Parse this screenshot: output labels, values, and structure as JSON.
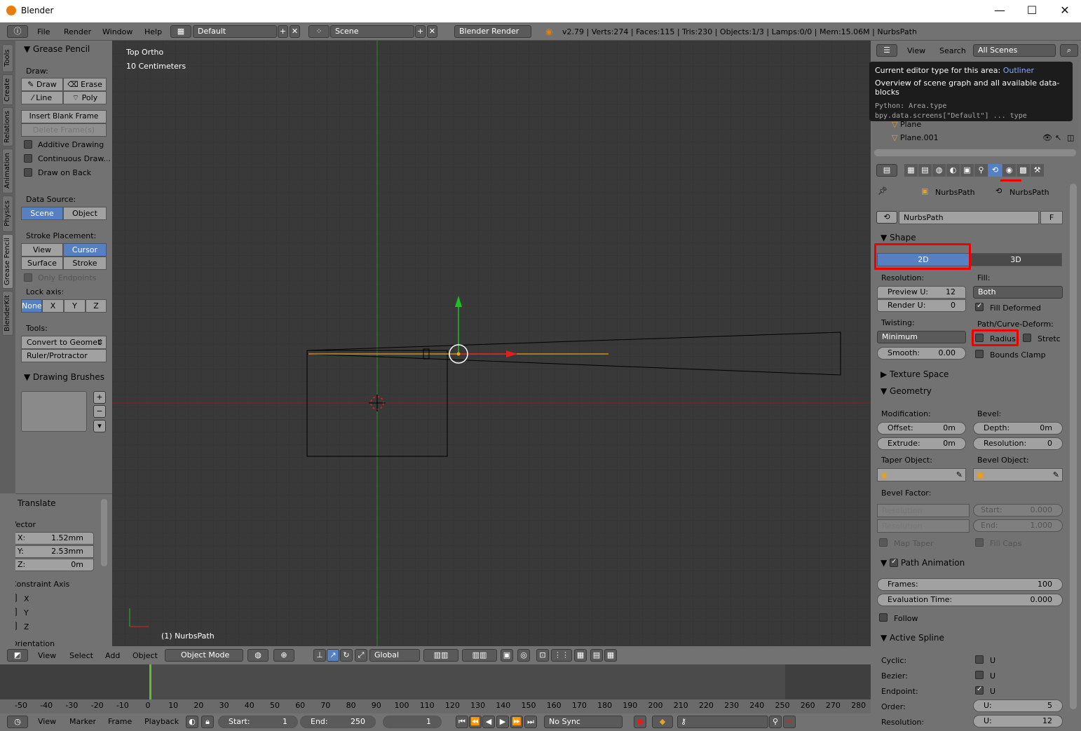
{
  "window": {
    "title": "Blender",
    "minimize": "—",
    "maximize": "☐",
    "close": "✕"
  },
  "topbar": {
    "menus": [
      "File",
      "Render",
      "Window",
      "Help"
    ],
    "layout": "Default",
    "scene": "Scene",
    "engine": "Blender Render",
    "stats": "v2.79 | Verts:274 | Faces:115 | Tris:230 | Objects:1/3 | Lamps:0/0 | Mem:15.06M | NurbsPath"
  },
  "vtabs": [
    "Tools",
    "Create",
    "Relations",
    "Animation",
    "Physics",
    "Grease Pencil",
    "BlenderKit"
  ],
  "grease_pencil": {
    "title": "Grease Pencil",
    "draw_label": "Draw:",
    "draw": "Draw",
    "erase": "Erase",
    "line": "Line",
    "poly": "Poly",
    "insert_blank": "Insert Blank Frame",
    "delete_frames": "Delete Frame(s)",
    "additive": "Additive Drawing",
    "continuous": "Continuous Draw...",
    "draw_on_back": "Draw on Back",
    "data_source_label": "Data Source:",
    "scene": "Scene",
    "object": "Object",
    "stroke_placement_label": "Stroke Placement:",
    "view": "View",
    "cursor": "Cursor",
    "surface": "Surface",
    "stroke": "Stroke",
    "only_endpoints": "Only Endpoints",
    "lock_axis_label": "Lock axis:",
    "none": "None",
    "x": "X",
    "y": "Y",
    "z": "Z",
    "tools_label": "Tools:",
    "convert": "Convert to Geomet",
    "ruler": "Ruler/Protractor",
    "brushes_title": "Drawing Brushes"
  },
  "translate": {
    "title": "Translate",
    "vector_label": "Vector",
    "x_label": "X:",
    "x": "1.52mm",
    "y_label": "Y:",
    "y": "2.53mm",
    "z_label": "Z:",
    "z": "0m",
    "constraint_label": "Constraint Axis",
    "cx": "X",
    "cy": "Y",
    "cz": "Z",
    "orientation": "Orientation"
  },
  "viewport": {
    "view_name": "Top Ortho",
    "scale": "10 Centimeters",
    "object_label": "(1) NurbsPath"
  },
  "vp_header": {
    "view": "View",
    "select": "Select",
    "add": "Add",
    "object": "Object",
    "mode": "Object Mode",
    "orientation": "Global"
  },
  "timeline": {
    "ticks": [
      "-50",
      "-40",
      "-30",
      "-20",
      "-10",
      "0",
      "10",
      "20",
      "30",
      "40",
      "50",
      "60",
      "70",
      "80",
      "90",
      "100",
      "110",
      "120",
      "130",
      "140",
      "150",
      "160",
      "170",
      "180",
      "190",
      "200",
      "210",
      "220",
      "230",
      "240",
      "250",
      "260",
      "270",
      "280"
    ],
    "menus": [
      "View",
      "Marker",
      "Frame",
      "Playback"
    ],
    "start_label": "Start:",
    "start": "1",
    "end_label": "End:",
    "end": "250",
    "current": "1",
    "sync": "No Sync"
  },
  "outliner": {
    "view": "View",
    "search": "Search",
    "scenes": "All Scenes",
    "items": [
      "Plane",
      "Plane.001"
    ]
  },
  "tooltip": {
    "line1_label": "Current editor type for this area:",
    "line1_value": "Outliner",
    "line2": "Overview of scene graph and all available data-blocks",
    "line3": "Python: Area.type",
    "line4": "bpy.data.screens[\"Default\"] ... type"
  },
  "properties": {
    "breadcrumb1": "NurbsPath",
    "breadcrumb2": "NurbsPath",
    "datablock": "NurbsPath",
    "datablock_flag": "F",
    "shape_title": "Shape",
    "btn_2d": "2D",
    "btn_3d": "3D",
    "resolution_label": "Resolution:",
    "fill_label": "Fill:",
    "preview_u_label": "Preview U:",
    "preview_u": "12",
    "render_u_label": "Render U:",
    "render_u": "0",
    "fill_value": "Both",
    "fill_deformed": "Fill Deformed",
    "twisting_label": "Twisting:",
    "path_deform_label": "Path/Curve-Deform:",
    "twisting_value": "Minimum",
    "radius": "Radius",
    "stretch": "Stretc",
    "smooth_label": "Smooth:",
    "smooth": "0.00",
    "bounds_clamp": "Bounds Clamp",
    "texture_space": "Texture Space",
    "geometry": "Geometry",
    "modification_label": "Modification:",
    "bevel_label": "Bevel:",
    "offset_label": "Offset:",
    "offset": "0m",
    "depth_label": "Depth:",
    "depth": "0m",
    "extrude_label": "Extrude:",
    "extrude": "0m",
    "bevel_res_label": "Resolution:",
    "bevel_res": "0",
    "taper_label": "Taper Object:",
    "bevel_obj_label": "Bevel Object:",
    "bevel_factor_label": "Bevel Factor:",
    "bf_res1": "Resolution",
    "bf_start_label": "Start:",
    "bf_start": "0.000",
    "bf_res2": "Resolution",
    "bf_end_label": "End:",
    "bf_end": "1.000",
    "map_taper": "Map Taper",
    "fill_caps": "Fill Caps",
    "path_animation": "Path Animation",
    "frames_label": "Frames:",
    "frames": "100",
    "eval_label": "Evaluation Time:",
    "eval": "0.000",
    "follow": "Follow",
    "active_spline": "Active Spline",
    "cyclic_label": "Cyclic:",
    "bezier_label": "Bezier:",
    "endpoint_label": "Endpoint:",
    "u": "U",
    "order_label": "Order:",
    "order_u_label": "U:",
    "order_u": "5",
    "resolution_row_label": "Resolution:",
    "res_u_label": "U:",
    "res_u": "12"
  },
  "colors": {
    "accent": "#5680c2",
    "highlight": "#ee0000",
    "x_axis": "#c02020",
    "y_axis": "#20a020"
  }
}
